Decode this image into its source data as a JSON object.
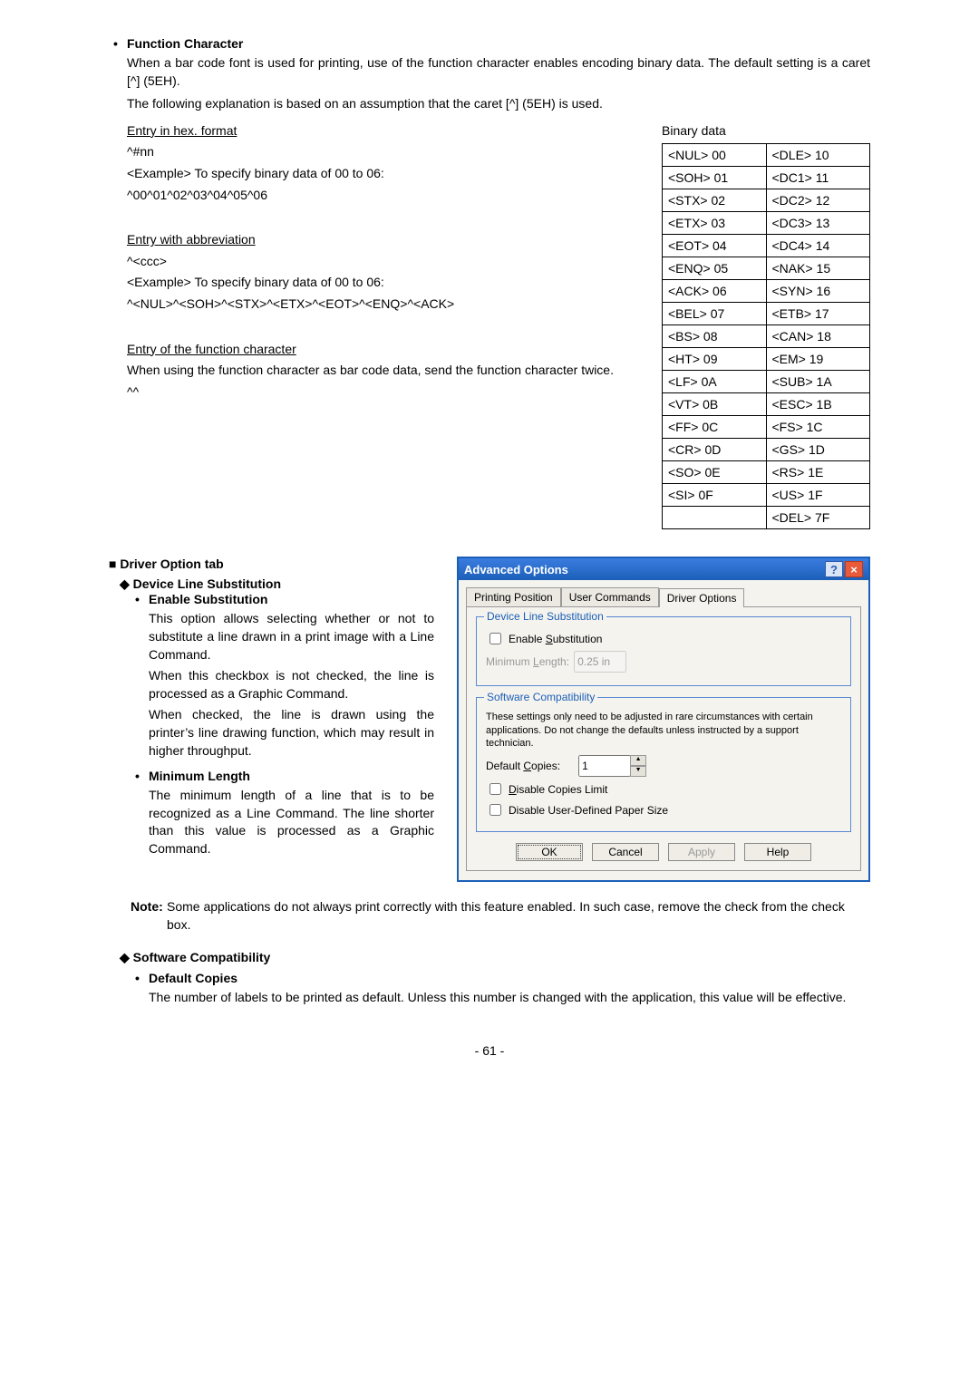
{
  "func_char": {
    "title": "Function Character",
    "p1": "When a bar code font is used for printing, use of the function character enables encoding binary data.  The default setting is a caret [^] (5EH).",
    "p2": "The following explanation is based on an assumption that the caret [^] (5EH) is used.",
    "hex_title": "Entry in hex. format",
    "hex_pat": "^#nn",
    "hex_ex": "<Example> To specify binary data of 00 to 06:",
    "hex_ex2": "^00^01^02^03^04^05^06",
    "abbr_title": "Entry with abbreviation",
    "abbr_pat": "^<ccc>",
    "abbr_ex": "<Example> To specify binary data of 00 to 06:",
    "abbr_ex2": "^<NUL>^<SOH>^<STX>^<ETX>^<EOT>^<ENQ>^<ACK>",
    "fc_title": "Entry of the function character",
    "fc_p": "When using the function character as bar code data, send the function character twice.",
    "fc_ex": "^^"
  },
  "binary_title": "Binary data",
  "binary": [
    [
      "<NUL> 00",
      "<DLE> 10"
    ],
    [
      "<SOH> 01",
      "<DC1> 11"
    ],
    [
      "<STX> 02",
      "<DC2> 12"
    ],
    [
      "<ETX> 03",
      "<DC3> 13"
    ],
    [
      "<EOT> 04",
      "<DC4> 14"
    ],
    [
      "<ENQ> 05",
      "<NAK> 15"
    ],
    [
      "<ACK> 06",
      "<SYN> 16"
    ],
    [
      "<BEL> 07",
      "<ETB> 17"
    ],
    [
      "<BS> 08",
      "<CAN> 18"
    ],
    [
      "<HT> 09",
      "<EM> 19"
    ],
    [
      "<LF> 0A",
      "<SUB> 1A"
    ],
    [
      "<VT> 0B",
      "<ESC> 1B"
    ],
    [
      "<FF> 0C",
      "<FS> 1C"
    ],
    [
      "<CR> 0D",
      "<GS> 1D"
    ],
    [
      "<SO> 0E",
      "<RS> 1E"
    ],
    [
      "<SI> 0F",
      "<US> 1F"
    ],
    [
      "",
      "<DEL> 7F"
    ]
  ],
  "driver": {
    "tab_title": "Driver Option tab",
    "dls_title": "Device Line Substitution",
    "es_title": "Enable Substitution",
    "es_p1": "This option allows selecting whether or not to substitute a line drawn in a print image with a Line Command.",
    "es_p2": "When this checkbox is not checked, the line is processed as a Graphic Command.",
    "es_p3": "When checked, the line is drawn using the printer’s line drawing function, which may result in higher throughput.",
    "ml_title": "Minimum Length",
    "ml_p": "The minimum length of a line that is to be recognized as a Line Command.  The line shorter than this value is processed as a Graphic Command.",
    "note_label": "Note:",
    "note": "Some applications do not always print correctly with this feature enabled.  In such case, remove the check from the check box.",
    "sc_title": "Software Compatibility",
    "dc_title": "Default Copies",
    "dc_p": "The number of labels to be printed as default.  Unless this number is changed with the application, this value will be effective."
  },
  "dialog": {
    "title": "Advanced Options",
    "tabs": {
      "t1": "Printing Position",
      "t2": "User Commands",
      "t3": "Driver Options"
    },
    "group1": {
      "title": "Device Line Substitution",
      "enable": "Enable Substitution",
      "minlen_label": "Minimum Length:",
      "minlen_value": "0.25 in"
    },
    "group2": {
      "title": "Software Compatibility",
      "desc": "These settings only need to be adjusted in rare circumstances with certain applications.  Do not change the defaults unless instructed by a support technician.",
      "copies_label": "Default Copies:",
      "copies_value": "1",
      "disable_copies": "Disable Copies Limit",
      "disable_paper": "Disable User-Defined Paper Size"
    },
    "buttons": {
      "ok": "OK",
      "cancel": "Cancel",
      "apply": "Apply",
      "help": "Help"
    }
  },
  "pagenum": "- 61 -"
}
